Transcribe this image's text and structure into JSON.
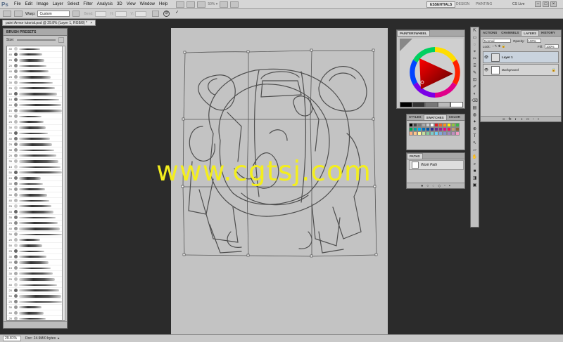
{
  "app": {
    "logo": "Ps",
    "menu": [
      "File",
      "Edit",
      "Image",
      "Layer",
      "Select",
      "Filter",
      "Analysis",
      "3D",
      "View",
      "Window",
      "Help"
    ],
    "workspaces": {
      "active": "ESSENTIALS",
      "others": [
        "DESIGN",
        "PAINTING"
      ]
    },
    "cs_live": "CS Live",
    "zoom_dropdown": "50% ▾"
  },
  "options": {
    "warp_label": "Warp:",
    "warp_value": "Custom",
    "faint_fields": [
      "Bend:",
      "H:",
      "V:"
    ],
    "cancel_glyph": "⊘",
    "commit_glyph": "✓"
  },
  "document": {
    "tab_title": "paint Armor tutorial.psd @ 29.8% (Layer 1, RGB/8) *",
    "close_glyph": "×"
  },
  "brush_presets": {
    "title": "BRUSH PRESETS",
    "size_label": "Size:",
    "numbers": [
      "40",
      "40",
      "25",
      "20",
      "40",
      "25",
      "30",
      "25",
      "60",
      "18",
      "40",
      "16",
      "50",
      "25",
      "30",
      "20",
      "40",
      "25",
      "38",
      "20",
      "35",
      "15",
      "50",
      "24",
      "30",
      "20",
      "30",
      "40",
      "25",
      "45",
      "35",
      "25",
      "40",
      "30",
      "20",
      "50",
      "25",
      "30",
      "40",
      "15",
      "30",
      "25",
      "40",
      "20",
      "50",
      "25",
      "30",
      "40",
      "20"
    ]
  },
  "painters_wheel": {
    "tabs": [
      "PAINTERSWHEEL"
    ],
    "swatches": [
      "#000000",
      "#333333",
      "#777777",
      "#bbbbbb",
      "#ffffff"
    ]
  },
  "swatches_panel": {
    "tabs": [
      "STYLES",
      "SWATCHES",
      "COLOR"
    ],
    "active": "SWATCHES",
    "colors": [
      "#000000",
      "#444444",
      "#777777",
      "#aaaaaa",
      "#cccccc",
      "#ffffff",
      "#e31c23",
      "#f26522",
      "#f7941d",
      "#fff200",
      "#8dc63f",
      "#39b54a",
      "#00a651",
      "#00a99d",
      "#00aeef",
      "#0072bc",
      "#0054a6",
      "#2e3192",
      "#662d91",
      "#92278f",
      "#ec008c",
      "#ed145b",
      "#c69c6d",
      "#8c6239",
      "#f9ad81",
      "#fdc689",
      "#fff799",
      "#c4df9b",
      "#82ca9c",
      "#7accc8",
      "#6dcff6",
      "#7da7d9",
      "#8393ca",
      "#a186be",
      "#bd8cbf",
      "#f49ac1"
    ]
  },
  "paths_panel": {
    "tabs": [
      "PATHS"
    ],
    "item": "Work Path"
  },
  "layers_panel": {
    "tabs": [
      "ACTIONS",
      "CHANNELS",
      "LAYERS",
      "HISTORY"
    ],
    "active": "LAYERS",
    "kind_label": "Kind",
    "blend_mode": "Normal",
    "opacity_label": "Opacity:",
    "opacity_value": "100%",
    "lock_label": "Lock:",
    "fill_label": "Fill:",
    "fill_value": "100%",
    "layers": [
      {
        "name": "Layer 1",
        "visible_glyph": "👁",
        "selected": true
      },
      {
        "name": "Background",
        "visible_glyph": "👁",
        "selected": false,
        "lock_glyph": "🔒"
      }
    ]
  },
  "tools": [
    "⇱",
    "▭",
    "◌",
    "⌖",
    "✂",
    "⌸",
    "✎",
    "⊡",
    "✐",
    "◐",
    "⌫",
    "▤",
    "◍",
    "✦",
    "⊕",
    "T",
    "↖",
    "▱",
    "✋",
    "⌕",
    "■",
    "◨",
    "▣"
  ],
  "watermark": "www.cgtsj.com",
  "status": {
    "zoom": "29.81%",
    "doc": "Doc: 24.9M/0 bytes",
    "arrow": "▸"
  }
}
